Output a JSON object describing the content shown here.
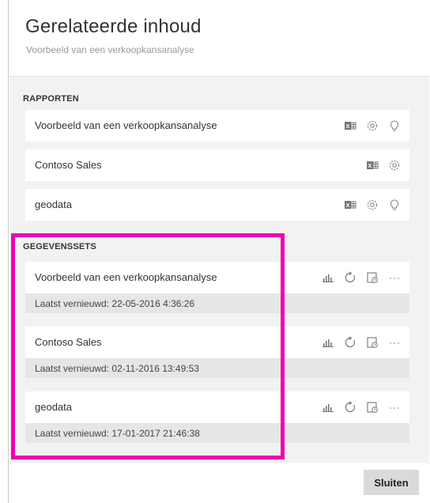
{
  "panel": {
    "title": "Gerelateerde inhoud",
    "subtitle": "Voorbeeld van een verkoopkansanalyse"
  },
  "reports": {
    "heading": "RAPPORTEN",
    "items": [
      {
        "name": "Voorbeeld van een verkoopkansanalyse",
        "icons": [
          "excel-icon",
          "gear-icon",
          "lightbulb-icon"
        ]
      },
      {
        "name": "Contoso Sales",
        "icons": [
          "excel-icon",
          "gear-icon"
        ]
      },
      {
        "name": "geodata",
        "icons": [
          "excel-icon",
          "gear-icon",
          "lightbulb-icon"
        ]
      }
    ]
  },
  "datasets": {
    "heading": "GEGEVENSSETS",
    "items": [
      {
        "name": "Voorbeeld van een verkoopkansanalyse",
        "refreshed": "Laatst vernieuwd: 22-05-2016 4:36:26"
      },
      {
        "name": "Contoso Sales",
        "refreshed": "Laatst vernieuwd: 02-11-2016 13:49:53"
      },
      {
        "name": "geodata",
        "refreshed": "Laatst vernieuwd: 17-01-2017 21:46:38"
      }
    ],
    "icons": [
      "create-report-icon",
      "refresh-icon",
      "schedule-refresh-icon",
      "more-options-icon"
    ]
  },
  "footer": {
    "close_label": "Sluiten"
  },
  "colors": {
    "highlight": "#ee00b4",
    "content_bg": "#f2f2f2",
    "refreshed_bg": "#e6e6e6",
    "button_bg": "#dadada"
  }
}
